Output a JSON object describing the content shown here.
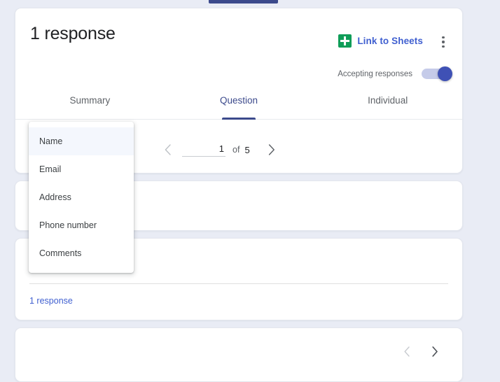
{
  "top_indicator": {
    "color": "#3c4a8c"
  },
  "header": {
    "response_count": "1 response",
    "sheets_link_label": "Link to Sheets",
    "sheets_icon": "sheets-icon",
    "more_icon": "kebab-menu-icon",
    "accepting_label": "Accepting responses",
    "accepting_state": "on",
    "accent_color": "#3f51b5",
    "link_color": "#3f5fd0",
    "sheets_green": "#0f9d58"
  },
  "tabs": [
    {
      "label": "Summary",
      "active": false
    },
    {
      "label": "Question",
      "active": true
    },
    {
      "label": "Individual",
      "active": false
    }
  ],
  "pagination": {
    "prev_icon": "chevron-left-icon",
    "next_icon": "chevron-right-icon",
    "current_page": "1",
    "of_label": "of",
    "total_pages": "5",
    "prev_enabled": false,
    "next_enabled": true
  },
  "question_dropdown": {
    "items": [
      {
        "label": "Name",
        "selected": true
      },
      {
        "label": "Email",
        "selected": false
      },
      {
        "label": "Address",
        "selected": false
      },
      {
        "label": "Phone number",
        "selected": false
      },
      {
        "label": "Comments",
        "selected": false
      }
    ]
  },
  "response_card": {
    "response_link_label": "1 response"
  },
  "bottom_nav": {
    "prev_icon": "chevron-left-icon",
    "next_icon": "chevron-right-icon",
    "prev_enabled": false,
    "next_enabled": true
  }
}
